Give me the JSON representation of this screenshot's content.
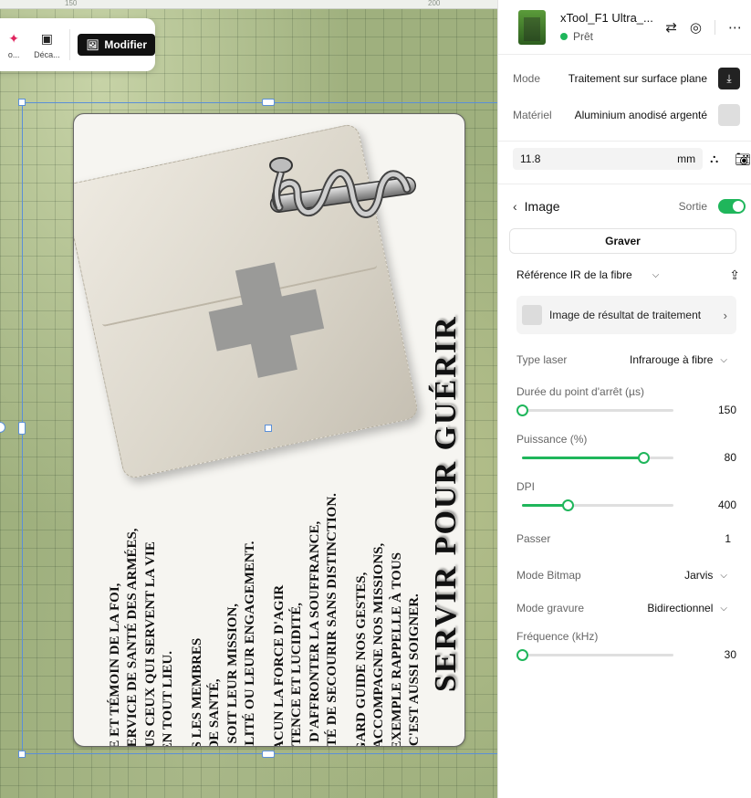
{
  "ruler": {
    "mark1": "150",
    "mark2": "200"
  },
  "toolbar": {
    "item1_label": "o...",
    "item2_label": "Déca...",
    "modify_label": "Modifier"
  },
  "card": {
    "title": "Servir pour guérir",
    "paragraphs": [
      "Saint Luc,\névangéliste et témoin de la foi,\npatron du service de santé des armées,\nguide de tous ceux qui servent la vie\nen OPEX et en tout lieu.",
      "Inspire tous les membres\ndu service de santé,\nquelle que soit leur mission,\nleur spécialité ou leur engagement.",
      "Donne à chacun la force d'agir\navec compétence et lucidité,\nle courage d'affronter la souffrance,\net la fidélité de secourir sans distinction.",
      "Que ton regard guide nos gestes,\nque ta paix accompagne nos missions,\net que ton exemple rappelle à tous\nque servir, c'est aussi soigner."
    ]
  },
  "device": {
    "name": "xTool_F1 Ultra_...",
    "status": "Prêt",
    "status_color": "#1fb65b"
  },
  "settings": {
    "mode_label": "Mode",
    "mode_value": "Traitement sur surface plane",
    "material_label": "Matériel",
    "material_value": "Aluminium anodisé argenté",
    "height_value": "11.8",
    "height_unit": "mm"
  },
  "image_section": {
    "title": "Image",
    "output_label": "Sortie",
    "output_on": true,
    "engrave_button": "Graver",
    "preset": "Référence IR de la fibre",
    "result_image": "Image de résultat de traitement",
    "laser_type_label": "Type laser",
    "laser_type_value": "Infrarouge à fibre",
    "dwell_label": "Durée du point d'arrêt (µs)",
    "dwell_value": "150",
    "dwell_fraction": 0.0,
    "power_label": "Puissance (%)",
    "power_value": "80",
    "power_fraction": 0.8,
    "dpi_label": "DPI",
    "dpi_value": "400",
    "dpi_fraction": 0.3,
    "pass_label": "Passer",
    "pass_value": "1",
    "bitmap_label": "Mode Bitmap",
    "bitmap_value": "Jarvis",
    "engrave_mode_label": "Mode gravure",
    "engrave_mode_value": "Bidirectionnel",
    "frequency_label": "Fréquence (kHz)",
    "frequency_value": "30",
    "frequency_fraction": 0.0
  },
  "colors": {
    "accent": "#1fb65b",
    "dark_button": "#111111"
  }
}
